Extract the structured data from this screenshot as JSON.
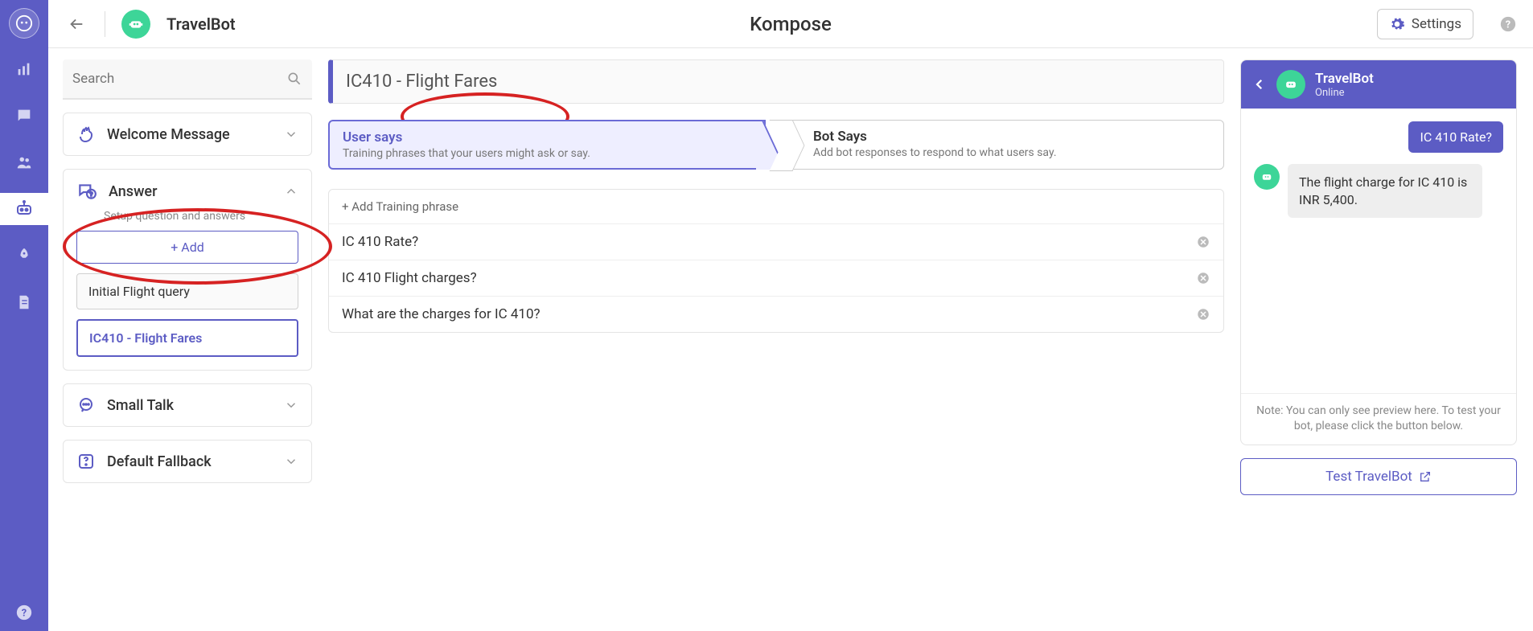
{
  "rail": {
    "items": [
      "analytics",
      "chat",
      "people",
      "bot",
      "rocket",
      "doc"
    ],
    "active_index": 3
  },
  "topbar": {
    "bot_name": "TravelBot",
    "app_title": "Kompose",
    "settings_label": "Settings"
  },
  "sidebar": {
    "search_placeholder": "Search",
    "cards": {
      "welcome": {
        "title": "Welcome Message"
      },
      "answer": {
        "title": "Answer",
        "subtitle": "Setup question and answers",
        "add_label": "+ Add",
        "intents": [
          {
            "label": "Initial Flight query",
            "active": false
          },
          {
            "label": "IC410 - Flight Fares",
            "active": true
          }
        ]
      },
      "smalltalk": {
        "title": "Small Talk"
      },
      "fallback": {
        "title": "Default Fallback"
      }
    }
  },
  "builder": {
    "intent_title_value": "IC410 - Flight Fares",
    "user_tab": {
      "title": "User says",
      "subtitle": "Training phrases that your users might ask or say."
    },
    "bot_tab": {
      "title": "Bot Says",
      "subtitle": "Add bot responses to respond to what users say."
    },
    "add_training_label": "+ Add Training phrase",
    "training_phrases": [
      "IC 410 Rate?",
      "IC 410 Flight charges?",
      "What are the charges for IC 410?"
    ]
  },
  "preview": {
    "header": {
      "bot_name": "TravelBot",
      "status": "Online"
    },
    "messages": {
      "user_msg": "IC 410 Rate?",
      "bot_msg": "The flight charge for IC 410 is INR 5,400."
    },
    "note": "Note: You can only see preview here. To test your bot, please click the button below.",
    "test_label": "Test TravelBot"
  }
}
